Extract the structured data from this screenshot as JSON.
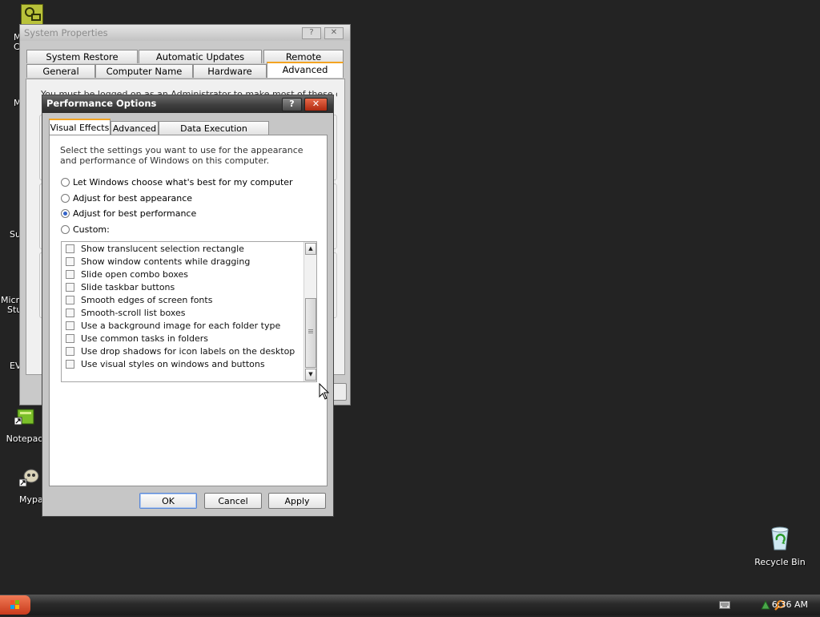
{
  "desktop": {
    "icons": [
      {
        "label": "Notepad"
      },
      {
        "label": "Mypa"
      },
      {
        "label": "Recycle Bin"
      }
    ],
    "fragments": [
      "M",
      "C",
      "M",
      "Su",
      "Micr",
      "Stu",
      "EV"
    ]
  },
  "system_properties": {
    "title": "System Properties",
    "help_btn": "?",
    "close_btn": "✕",
    "tabs_top": [
      "System Restore",
      "Automatic Updates",
      "Remote"
    ],
    "tabs_bottom": [
      "General",
      "Computer Name",
      "Hardware",
      "Advanced"
    ],
    "active_tab": "Advanced",
    "partial_text": "You must be logged on as an Administrator to make most of these changes."
  },
  "performance_options": {
    "title": "Performance Options",
    "help_btn": "?",
    "close_btn": "✕",
    "tabs": [
      "Visual Effects",
      "Advanced",
      "Data Execution Prevention"
    ],
    "active_tab": "Visual Effects",
    "description": "Select the settings you want to use for the appearance and performance of Windows on this computer.",
    "radios": [
      {
        "label": "Let Windows choose what's best for my computer",
        "selected": false
      },
      {
        "label": "Adjust for best appearance",
        "selected": false
      },
      {
        "label": "Adjust for best performance",
        "selected": true
      },
      {
        "label": "Custom:",
        "selected": false
      }
    ],
    "checkboxes": [
      {
        "label": "Show translucent selection rectangle",
        "checked": false
      },
      {
        "label": "Show window contents while dragging",
        "checked": false
      },
      {
        "label": "Slide open combo boxes",
        "checked": false
      },
      {
        "label": "Slide taskbar buttons",
        "checked": false
      },
      {
        "label": "Smooth edges of screen fonts",
        "checked": false
      },
      {
        "label": "Smooth-scroll list boxes",
        "checked": false
      },
      {
        "label": "Use a background image for each folder type",
        "checked": false
      },
      {
        "label": "Use common tasks in folders",
        "checked": false
      },
      {
        "label": "Use drop shadows for icon labels on the desktop",
        "checked": false
      },
      {
        "label": "Use visual styles on windows and buttons",
        "checked": false
      }
    ],
    "scroll": {
      "up": "▲",
      "down": "▼"
    },
    "buttons": {
      "ok": "OK",
      "cancel": "Cancel",
      "apply": "Apply"
    }
  },
  "taskbar": {
    "clock": "6:36 AM"
  },
  "colors": {
    "desktop_bg": "#232323",
    "active_tab_accent": "#f3a422",
    "close_button": "#c8381a",
    "radio_dot": "#3463c8"
  }
}
